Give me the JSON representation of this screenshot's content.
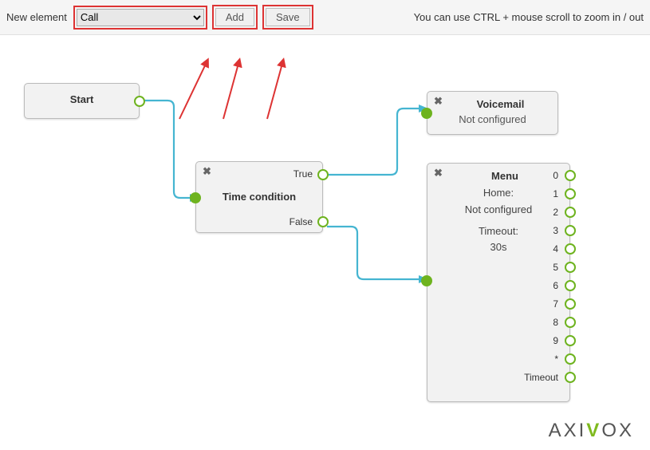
{
  "toolbar": {
    "label": "New element",
    "select_value": "Call",
    "add_label": "Add",
    "save_label": "Save",
    "hint": "You can use CTRL + mouse scroll to zoom in / out"
  },
  "nodes": {
    "start": {
      "title": "Start"
    },
    "time_condition": {
      "title": "Time condition",
      "out_true": "True",
      "out_false": "False"
    },
    "voicemail": {
      "title": "Voicemail",
      "subtitle": "Not configured"
    },
    "menu": {
      "title": "Menu",
      "home_label": "Home:",
      "home_value": "Not configured",
      "timeout_label": "Timeout:",
      "timeout_value": "30s",
      "outputs": [
        "0",
        "1",
        "2",
        "3",
        "4",
        "5",
        "6",
        "7",
        "8",
        "9",
        "*",
        "Timeout"
      ]
    }
  },
  "brand": "AXIVOX",
  "annotations": {
    "highlight_color": "#d33",
    "arrows": [
      "select",
      "add",
      "save"
    ]
  }
}
